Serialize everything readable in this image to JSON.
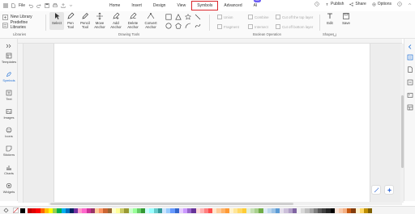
{
  "menubar": {
    "file_label": "File",
    "tabs": [
      "Home",
      "Insert",
      "Design",
      "View",
      "Symbols",
      "Advanced",
      "AI"
    ],
    "active_tab": "Symbols",
    "ai_badge": "hot",
    "right": [
      "Publish",
      "Share",
      "Options"
    ]
  },
  "ribbon": {
    "libraries": {
      "new_library": "New Library",
      "predefine_libraries": "Predefine Libraries",
      "group_label": "Libraries"
    },
    "tools": [
      {
        "label1": "Select",
        "label2": "",
        "icon": "cursor-icon"
      },
      {
        "label1": "Pen",
        "label2": "Tool",
        "icon": "pen-icon"
      },
      {
        "label1": "Pencil",
        "label2": "Tool",
        "icon": "pencil-icon"
      },
      {
        "label1": "Move",
        "label2": "Anchor",
        "icon": "move-anchor-icon"
      },
      {
        "label1": "Add",
        "label2": "Anchor",
        "icon": "add-anchor-icon"
      },
      {
        "label1": "Delete",
        "label2": "Anchor",
        "icon": "delete-anchor-icon"
      },
      {
        "label1": "Convert",
        "label2": "Anchor",
        "icon": "convert-anchor-icon"
      }
    ],
    "drawing_tools_label": "Drawing Tools",
    "boolean": {
      "union": "Union",
      "combine": "Combine",
      "cut_top": "Cut off the top layer",
      "fragment": "Fragment",
      "intersect": "Intersect",
      "cut_bottom": "Cut off bottom layer",
      "group_label": "Boolean Operation"
    },
    "edit_shapes": {
      "label": "Edit",
      "group_label": "Shapes"
    },
    "save": {
      "label": "Save"
    }
  },
  "sidebar": {
    "items": [
      {
        "label": "Templates",
        "icon": "template-icon"
      },
      {
        "label": "Symbols",
        "icon": "symbols-icon"
      },
      {
        "label": "Text",
        "icon": "text-icon"
      },
      {
        "label": "Images",
        "icon": "images-icon"
      },
      {
        "label": "Icons",
        "icon": "icons-icon"
      },
      {
        "label": "Stickers",
        "icon": "stickers-icon"
      },
      {
        "label": "Charts",
        "icon": "charts-icon"
      },
      {
        "label": "Widgets",
        "icon": "widgets-icon"
      }
    ],
    "active": "Symbols"
  },
  "palette": {
    "colors": [
      "#c00000",
      "#e00000",
      "#ff0000",
      "#ff6600",
      "#ffc000",
      "#ffff00",
      "#92d050",
      "#00b050",
      "#00b0f0",
      "#0070c0",
      "#002060",
      "#7030a0",
      "#ff99cc",
      "#ff66cc",
      "#cc3399",
      "#993366",
      "#ffcc99",
      "#ff9966",
      "#cc6633",
      "#996633",
      "#ffffcc",
      "#ffff99",
      "#cccc66",
      "#999933",
      "#ccffcc",
      "#99ff99",
      "#66cc66",
      "#339933",
      "#ccffff",
      "#99ffff",
      "#66cccc",
      "#339999",
      "#cce5ff",
      "#99ccff",
      "#6699ff",
      "#3366cc",
      "#e5ccff",
      "#cc99ff",
      "#9966cc",
      "#663399",
      "#ffd9d9",
      "#ffb3b3",
      "#ff8080",
      "#ff4d4d",
      "#ffe6cc",
      "#ffcc99",
      "#ffb366",
      "#ff9933",
      "#fff2cc",
      "#ffe699",
      "#ffd966",
      "#ffcc33",
      "#e2efda",
      "#c6e0b4",
      "#a9d08e",
      "#70ad47",
      "#ddebf7",
      "#bdd7ee",
      "#9bc2e6",
      "#5b9bd5",
      "#e4dfec",
      "#ccc0da",
      "#b1a0c7",
      "#8064a2",
      "#f2f2f2",
      "#d9d9d9",
      "#bfbfbf",
      "#a6a6a6",
      "#808080",
      "#595959",
      "#404040",
      "#262626",
      "#000000",
      "#fce4d6",
      "#f8cbad",
      "#f4b084",
      "#c65911",
      "#833c0c",
      "#fff2cc",
      "#ffd966",
      "#bf8f00",
      "#7f6000"
    ]
  }
}
